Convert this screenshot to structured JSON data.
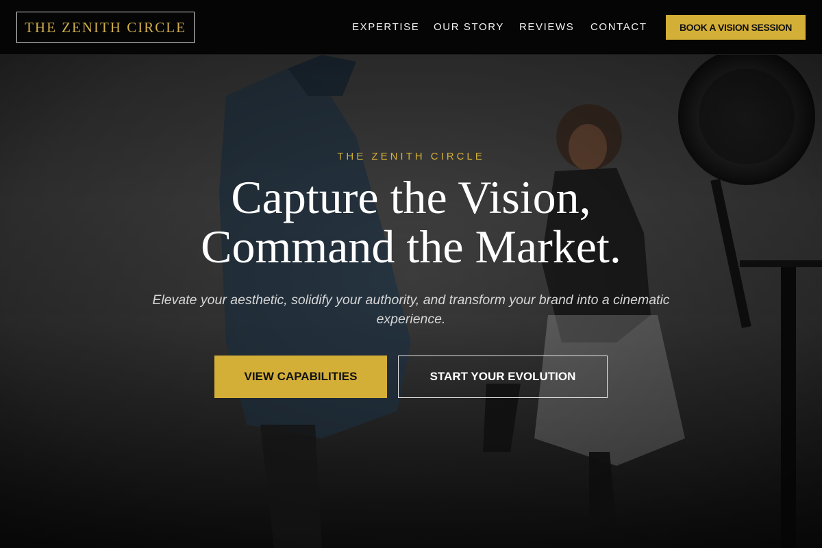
{
  "header": {
    "logo": "THE ZENITH CIRCLE",
    "nav": [
      {
        "label": "EXPERTISE"
      },
      {
        "label": "OUR STORY"
      },
      {
        "label": "REVIEWS"
      },
      {
        "label": "CONTACT"
      }
    ],
    "cta": "BOOK A VISION SESSION"
  },
  "hero": {
    "eyebrow": "THE ZENITH CIRCLE",
    "headline_line1": "Capture the Vision,",
    "headline_line2": "Command the Market.",
    "subtitle": "Elevate your aesthetic, solidify your authority, and transform your brand into a cinematic experience.",
    "primary_button": "VIEW CAPABILITIES",
    "secondary_button": "START YOUR EVOLUTION"
  },
  "colors": {
    "accent": "#d4af37",
    "header_bg": "#050505",
    "text": "#ffffff"
  }
}
